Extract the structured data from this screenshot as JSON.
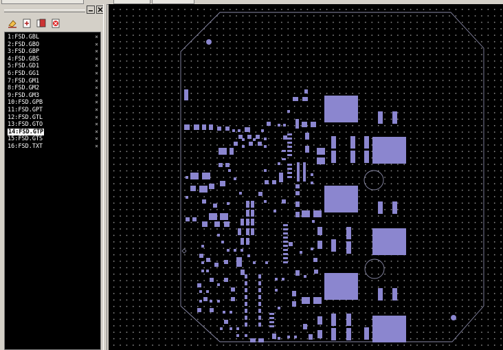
{
  "colors": {
    "canvas_bg": "#000000",
    "pad": "#8b86cf",
    "outline": "#8a8aa8",
    "panel_bg": "#d4d0c8",
    "selected_bg": "#ffffff"
  },
  "panel": {
    "minimize_icon": "minimize-icon",
    "close_icon": "close-icon",
    "toolbar": [
      {
        "name": "eraser-icon"
      },
      {
        "name": "add-layer-icon"
      },
      {
        "name": "layers-icon"
      },
      {
        "name": "delete-layer-icon"
      }
    ]
  },
  "layers": [
    {
      "label": "1:FSD.GBL",
      "remove": "×"
    },
    {
      "label": "2:FSD.GBO",
      "remove": "×"
    },
    {
      "label": "3:FSD.GBP",
      "remove": "×"
    },
    {
      "label": "4:FSD.GBS",
      "remove": "×"
    },
    {
      "label": "5:FSD.GD1",
      "remove": "×"
    },
    {
      "label": "6:FSD.GG1",
      "remove": "×"
    },
    {
      "label": "7:FSD.GM1",
      "remove": "×"
    },
    {
      "label": "8:FSD.GM2",
      "remove": "×"
    },
    {
      "label": "9:FSD.GM3",
      "remove": "×"
    },
    {
      "label": "10:FSD.GPB",
      "remove": "×"
    },
    {
      "label": "11:FSD.GPT",
      "remove": "×"
    },
    {
      "label": "12:FSD.GTL",
      "remove": "×"
    },
    {
      "label": "13:FSD.GTO",
      "remove": "×"
    },
    {
      "label": "14:FSD.GTP",
      "remove": "×",
      "selected": true
    },
    {
      "label": "15:FSD.GTS",
      "remove": "×"
    },
    {
      "label": "16:FSD.TXT",
      "remove": "×"
    }
  ]
}
